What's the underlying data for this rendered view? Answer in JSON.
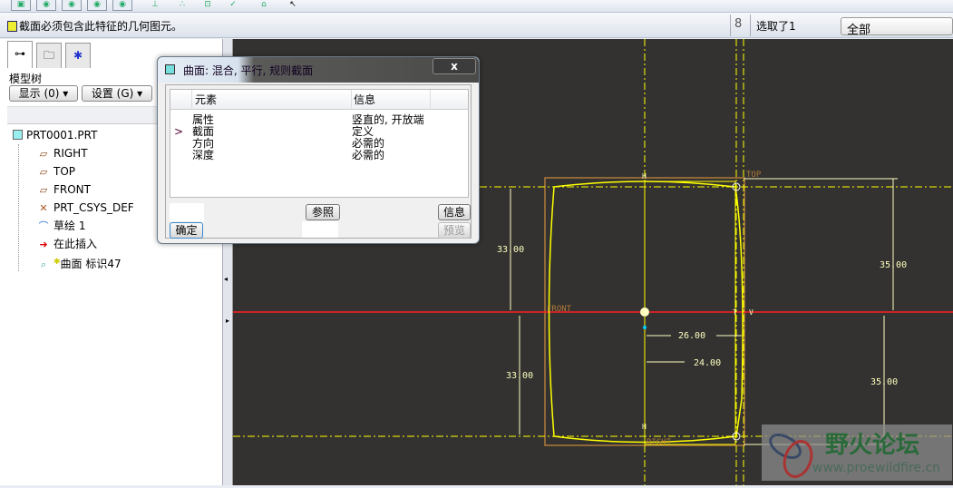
{
  "toolbar": {
    "icons": [
      "copy-icon",
      "view-icon",
      "view-icon",
      "view-icon",
      "view-icon",
      "datum-icon",
      "point-icon",
      "sketch-icon",
      "check-icon",
      "measure-icon",
      "select-arrow-icon"
    ]
  },
  "message": {
    "text": "截面必须包含此特征的几何图元。"
  },
  "selection": {
    "text": "选取了1",
    "filter": "全部"
  },
  "left_panel": {
    "tabs": [
      "model-tree-tab",
      "layer-tab",
      "favorites-tab"
    ],
    "title": "模型树",
    "show_button": "显示 (0) ▾",
    "settings_button": "设置 (G) ▾",
    "tree": {
      "root": "PRT0001.PRT",
      "items": [
        {
          "label": "RIGHT",
          "icon": "datum-plane-icon"
        },
        {
          "label": "TOP",
          "icon": "datum-plane-icon"
        },
        {
          "label": "FRONT",
          "icon": "datum-plane-icon"
        },
        {
          "label": "PRT_CSYS_DEF",
          "icon": "csys-icon"
        },
        {
          "label": "草绘 1",
          "icon": "sketch-icon"
        },
        {
          "label": "在此插入",
          "icon": "insert-arrow-icon"
        },
        {
          "label": "曲面 标识47",
          "icon": "surface-icon"
        }
      ]
    }
  },
  "dialog": {
    "title": "曲面: 混合, 平行, 规则截面",
    "close": "x",
    "columns": [
      "元素",
      "信息"
    ],
    "rows": [
      {
        "element": "属性",
        "info": "竖直的, 开放端",
        "current": false
      },
      {
        "element": "截面",
        "info": "定义",
        "current": true
      },
      {
        "element": "方向",
        "info": "必需的",
        "current": false
      },
      {
        "element": "深度",
        "info": "必需的",
        "current": false
      }
    ],
    "current_marker": ">",
    "buttons": {
      "ref": "参照",
      "info": "信息",
      "ok": "确定",
      "preview": "预览"
    }
  },
  "sketch": {
    "datum_labels": {
      "top": "TOP",
      "front": "FRONT",
      "right": "RIGHT",
      "h": "H",
      "v": "V",
      "t": "T"
    },
    "dimensions": [
      "33.00",
      "33.00",
      "35.00",
      "35.00",
      "26.00",
      "24.00"
    ],
    "colors": {
      "background": "#333230",
      "sketch": "#ffff00",
      "front": "#ff2020",
      "datum": "#b07a3a",
      "dimension": "#ffffc0"
    }
  },
  "watermark": {
    "title": "野火论坛",
    "url": "www.proewildfire.cn"
  }
}
